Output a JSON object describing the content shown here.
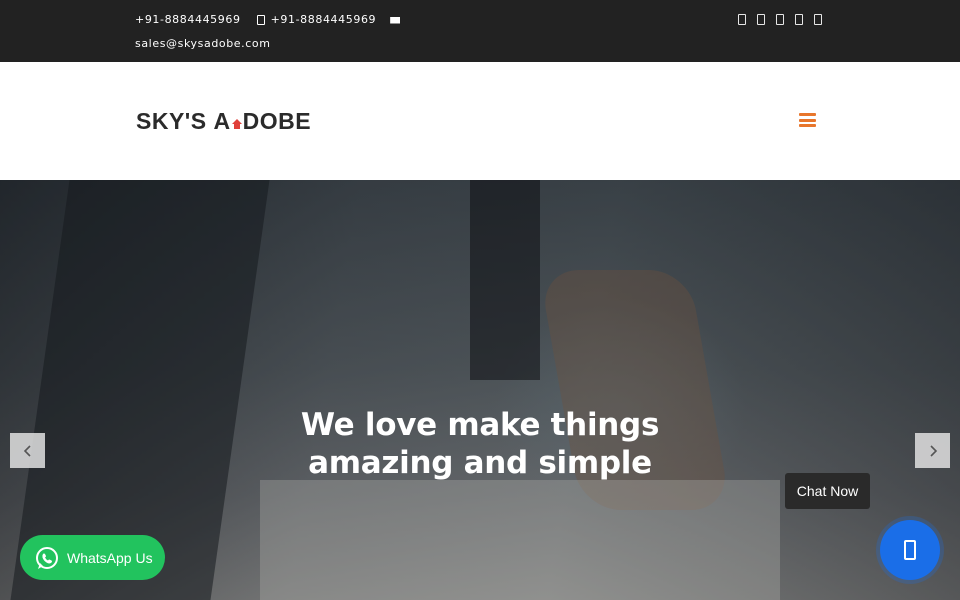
{
  "topbar": {
    "phone1": "+91-8884445969",
    "phone2": "+91-8884445969",
    "email": "sales@skysadobe.com",
    "social_icons": [
      "facebook-icon",
      "twitter-icon",
      "instagram-icon",
      "linkedin-icon",
      "youtube-icon"
    ]
  },
  "header": {
    "logo_text_left": "SKY'S ",
    "logo_text_a": "A",
    "logo_text_right": "DOBE",
    "menu_icon": "hamburger-menu-icon",
    "menu_color": "#e8762c"
  },
  "hero": {
    "title_line1": "We love make things",
    "title_line2": "amazing and simple",
    "prev_icon": "chevron-left-icon",
    "next_icon": "chevron-right-icon"
  },
  "widgets": {
    "whatsapp_label": "WhatsApp Us",
    "whatsapp_color": "#22c35e",
    "chat_tooltip": "Chat Now",
    "chat_color": "#1a6ee8"
  }
}
